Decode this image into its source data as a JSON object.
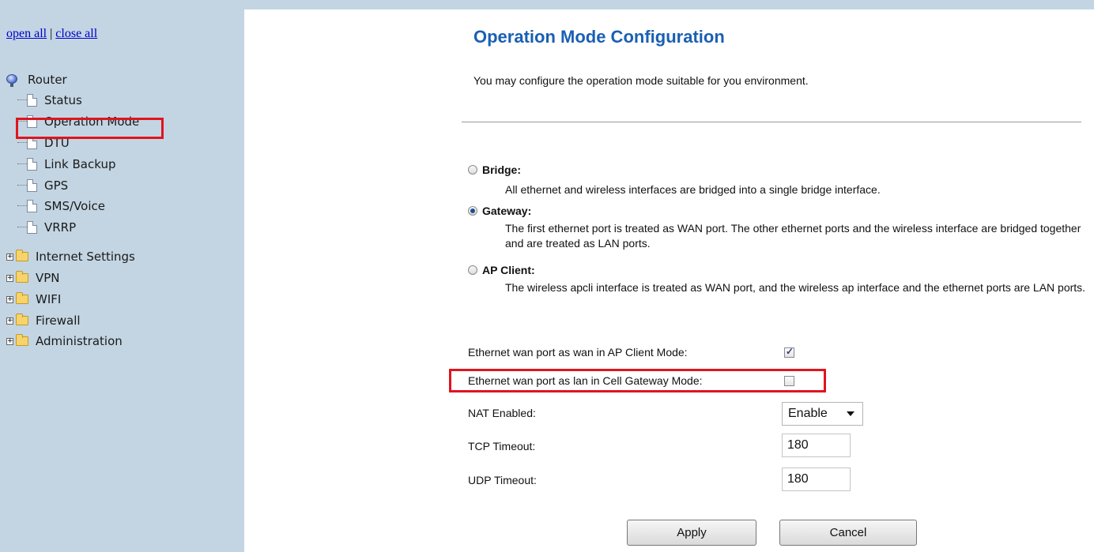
{
  "nav": {
    "open_all": "open all",
    "separator": "|",
    "close_all": "close all",
    "root_label": "Router",
    "items": [
      {
        "label": "Status",
        "type": "page"
      },
      {
        "label": "Operation Mode",
        "type": "page",
        "selected": true
      },
      {
        "label": "DTU",
        "type": "page"
      },
      {
        "label": "Link Backup",
        "type": "page"
      },
      {
        "label": "GPS",
        "type": "page"
      },
      {
        "label": "SMS/Voice",
        "type": "page"
      },
      {
        "label": "VRRP",
        "type": "page"
      },
      {
        "label": "Internet Settings",
        "type": "folder"
      },
      {
        "label": "VPN",
        "type": "folder"
      },
      {
        "label": "WIFI",
        "type": "folder"
      },
      {
        "label": "Firewall",
        "type": "folder"
      },
      {
        "label": "Administration",
        "type": "folder"
      }
    ]
  },
  "main": {
    "title": "Operation Mode Configuration",
    "intro": "You may configure the operation mode suitable for you environment.",
    "modes": [
      {
        "label": "Bridge:",
        "selected": false,
        "desc": "All ethernet and wireless interfaces are bridged into a single bridge interface."
      },
      {
        "label": "Gateway:",
        "selected": true,
        "desc": "The first ethernet port is treated as WAN port. The other ethernet ports and the wireless interface are bridged together and are treated as LAN ports."
      },
      {
        "label": "AP Client:",
        "selected": false,
        "desc": "The wireless apcli interface is treated as WAN port, and the wireless ap interface and the ethernet ports are LAN ports."
      }
    ],
    "eth_wan_ap_label": "Ethernet wan port as wan in AP Client Mode:",
    "eth_wan_ap_checked": true,
    "eth_wan_cell_label": "Ethernet wan port as lan in Cell Gateway Mode:",
    "eth_wan_cell_checked": false,
    "nat_label": "NAT Enabled:",
    "nat_value": "Enable",
    "tcp_label": "TCP Timeout:",
    "tcp_value": "180",
    "udp_label": "UDP Timeout:",
    "udp_value": "180",
    "apply_label": "Apply",
    "cancel_label": "Cancel"
  },
  "colors": {
    "sidebar_bg": "#c3d5e3",
    "title": "#1a5fb4",
    "highlight": "#e0141e"
  }
}
